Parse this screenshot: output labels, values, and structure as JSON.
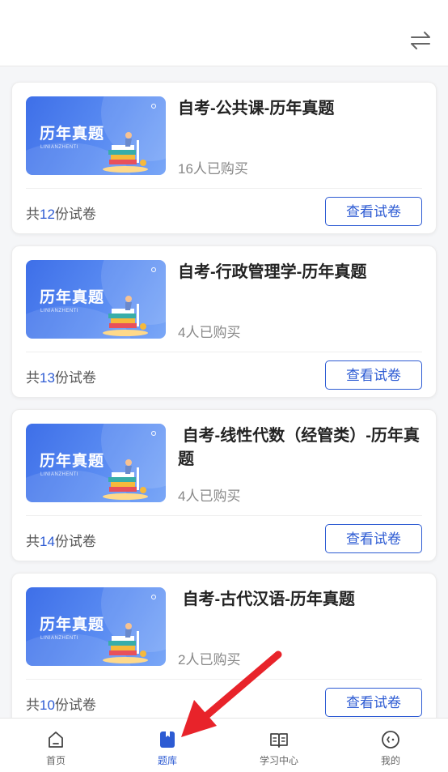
{
  "header": {
    "swap_icon": "swap-arrows-icon"
  },
  "cards": [
    {
      "title": "自考-公共课-历年真题",
      "buyers": "16人已购买",
      "count_prefix": "共",
      "count_num": "12",
      "count_suffix": "份试卷",
      "button": "查看试卷",
      "thumb_title": "历年真题",
      "thumb_sub": "LINIANZHENTI"
    },
    {
      "title": "自考-行政管理学-历年真题",
      "buyers": "4人已购买",
      "count_prefix": "共",
      "count_num": "13",
      "count_suffix": "份试卷",
      "button": "查看试卷",
      "thumb_title": "历年真题",
      "thumb_sub": "LINIANZHENTI"
    },
    {
      "title": " 自考-线性代数（经管类）-历年真题",
      "buyers": "4人已购买",
      "count_prefix": "共",
      "count_num": "14",
      "count_suffix": "份试卷",
      "button": "查看试卷",
      "thumb_title": "历年真题",
      "thumb_sub": "LINIANZHENTI"
    },
    {
      "title": " 自考-古代汉语-历年真题",
      "buyers": "2人已购买",
      "count_prefix": "共",
      "count_num": "10",
      "count_suffix": "份试卷",
      "button": "查看试卷",
      "thumb_title": "历年真题",
      "thumb_sub": "LINIANZHENTI"
    }
  ],
  "tabbar": {
    "items": [
      {
        "label": "首页",
        "icon": "home-icon",
        "active": false
      },
      {
        "label": "题库",
        "icon": "question-bank-icon",
        "active": true
      },
      {
        "label": "学习中心",
        "icon": "book-icon",
        "active": false
      },
      {
        "label": "我的",
        "icon": "profile-face-icon",
        "active": false
      }
    ]
  },
  "colors": {
    "accent": "#2d5bd3",
    "annotation_arrow": "#e8232a"
  }
}
